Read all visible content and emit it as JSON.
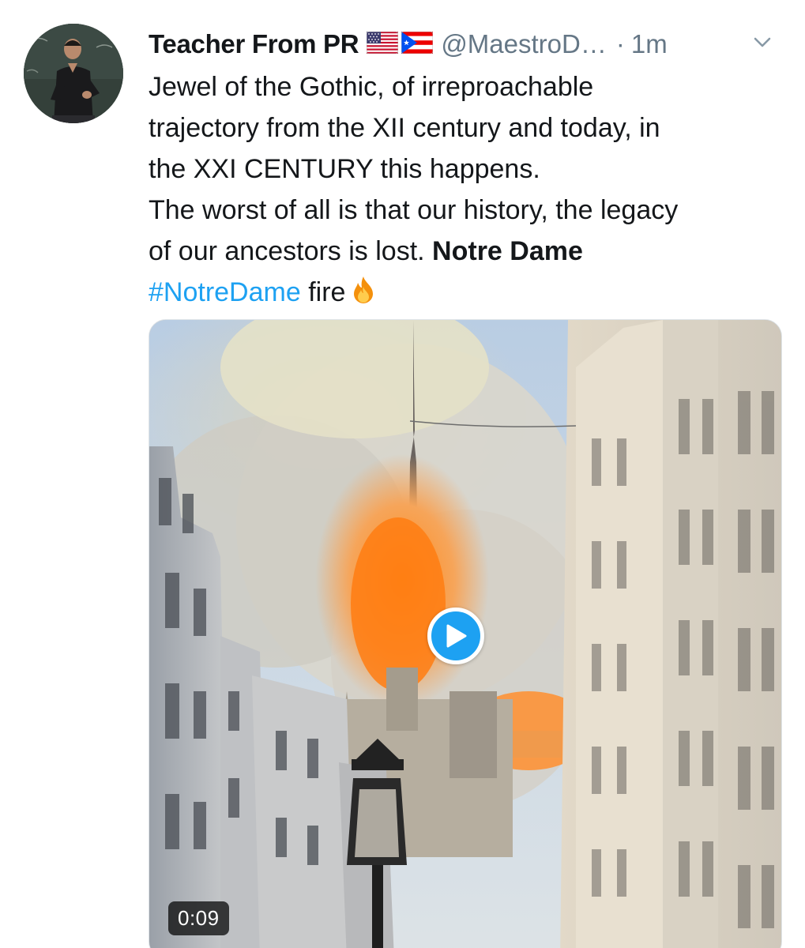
{
  "tweet": {
    "display_name": "Teacher From PR",
    "flags": [
      "us-flag-icon",
      "puerto-rico-flag-icon"
    ],
    "handle": "@MaestroD…",
    "separator": "·",
    "time": "1m",
    "body_lines": [
      "Jewel of the Gothic, of irreproachable",
      "trajectory from the XII century and today, in",
      "the XXI CENTURY this happens.",
      "The worst of all is that our history, the legacy"
    ],
    "line5_text": "of our ancestors is lost. ",
    "line5_bold": "Notre Dame",
    "hashtag": "#NotreDame",
    "after_hashtag": " fire",
    "emoji_icon": "fire-icon",
    "media": {
      "type": "video",
      "duration": "0:09",
      "play_icon": "play-icon"
    }
  },
  "colors": {
    "text": "#14171a",
    "secondary": "#657786",
    "accent": "#1da1f2"
  }
}
